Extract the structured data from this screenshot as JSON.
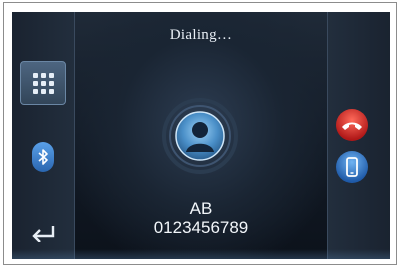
{
  "screen": {
    "title": "Dialing…"
  },
  "contact": {
    "name": "AB",
    "number": "0123456789",
    "avatar_icon": "person-avatar-icon"
  },
  "left_panel": {
    "keypad_icon": "keypad-icon",
    "bluetooth_icon": "bluetooth-icon",
    "back_icon": "back-arrow-icon"
  },
  "right_panel": {
    "hangup_icon": "hang-up-icon",
    "handset_icon": "mobile-phone-icon"
  },
  "colors": {
    "hangup": "#d42a2a",
    "handset": "#2a6fc4",
    "accent": "#5aa0e8"
  }
}
